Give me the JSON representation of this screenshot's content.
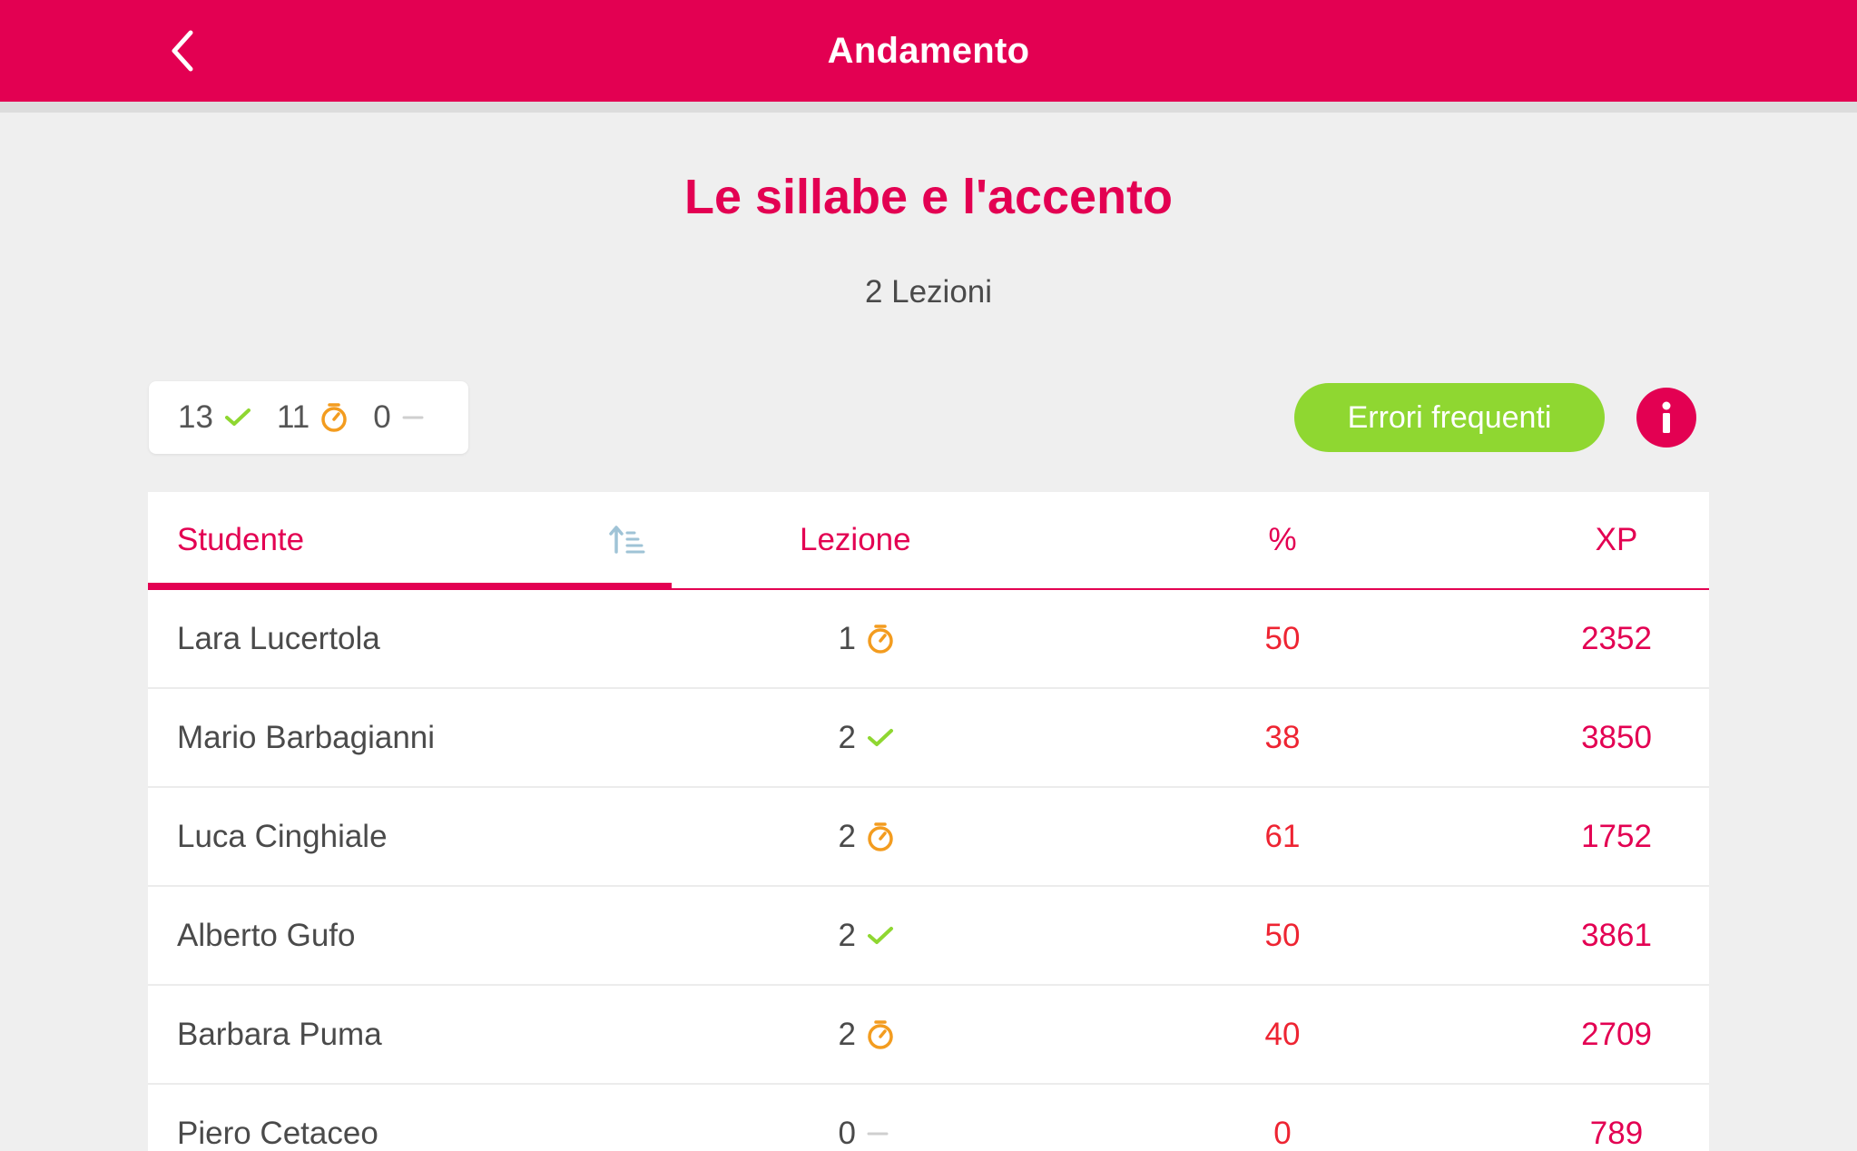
{
  "header": {
    "title": "Andamento",
    "background_color": "#e30052",
    "back_icon": "chevron-left-icon"
  },
  "course": {
    "title": "Le sillabe e l'accento",
    "subtitle": "2 Lezioni"
  },
  "summary": {
    "completed": "13",
    "in_progress": "11",
    "not_started": "0",
    "icons": [
      "check-icon",
      "timer-icon",
      "dash-icon"
    ]
  },
  "actions": {
    "errori_label": "Errori frequenti",
    "errori_color": "#8fd731",
    "info_icon": "info-icon"
  },
  "table": {
    "columns": [
      "Studente",
      "Lezione",
      "%",
      "XP"
    ],
    "sort_icon": "sort-ascending-icon",
    "rows": [
      {
        "name": "Lara Lucertola",
        "lesson": "1",
        "status": "timer",
        "pct": "50",
        "xp": "2352"
      },
      {
        "name": "Mario Barbagianni",
        "lesson": "2",
        "status": "check",
        "pct": "38",
        "xp": "3850"
      },
      {
        "name": "Luca Cinghiale",
        "lesson": "2",
        "status": "timer",
        "pct": "61",
        "xp": "1752"
      },
      {
        "name": "Alberto Gufo",
        "lesson": "2",
        "status": "check",
        "pct": "50",
        "xp": "3861"
      },
      {
        "name": "Barbara Puma",
        "lesson": "2",
        "status": "timer",
        "pct": "40",
        "xp": "2709"
      },
      {
        "name": "Piero Cetaceo",
        "lesson": "0",
        "status": "dash",
        "pct": "0",
        "xp": "789"
      }
    ]
  },
  "colors": {
    "accent": "#e30052",
    "check": "#8fd731",
    "timer": "#f39c1f",
    "percent": "#ee2432"
  }
}
